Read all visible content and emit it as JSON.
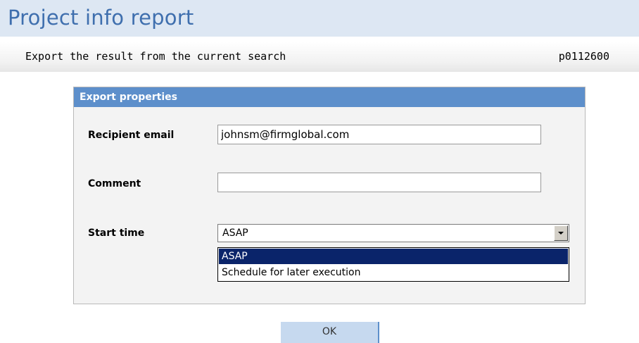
{
  "header": {
    "title": "Project info report"
  },
  "subheader": {
    "description": "Export the result from the current search",
    "report_id": "p0112600"
  },
  "panel": {
    "title": "Export properties",
    "fields": {
      "email": {
        "label": "Recipient email",
        "value": "johnsm@firmglobal.com"
      },
      "comment": {
        "label": "Comment",
        "value": ""
      },
      "start_time": {
        "label": "Start time",
        "selected": "ASAP",
        "options": [
          "ASAP",
          "Schedule for later execution"
        ],
        "highlighted_option": "ASAP",
        "dropdown_open": true
      }
    }
  },
  "actions": {
    "ok_label": "OK"
  },
  "colors": {
    "title_bar_bg": "#dde7f3",
    "title_text": "#3f6fae",
    "panel_header_bg": "#5d8fcb",
    "selected_option_bg": "#0a246a",
    "ok_button_bg": "#c6d9ef"
  },
  "icons": {
    "select_arrow": "chevron-down-icon"
  }
}
